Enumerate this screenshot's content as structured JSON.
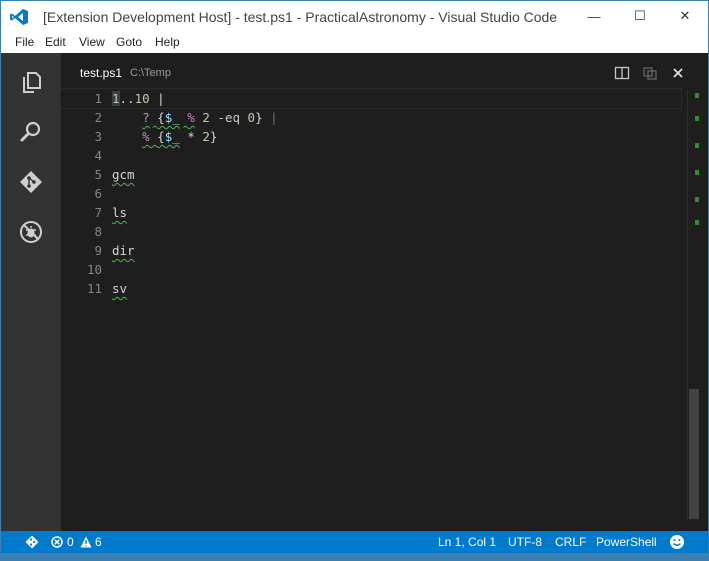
{
  "window": {
    "title": "[Extension Development Host] - test.ps1 - PracticalAstronomy - Visual Studio Code",
    "controls": {
      "minimize": "—",
      "maximize": "☐",
      "close": "✕"
    }
  },
  "menu": {
    "file": "File",
    "edit": "Edit",
    "view": "View",
    "goto": "Goto",
    "help": "Help"
  },
  "activity_bar": {
    "icons": [
      "files-icon",
      "search-icon",
      "git-icon",
      "debug-icon"
    ]
  },
  "editor": {
    "tab_title": "test.ps1",
    "tab_path": "C:\\Temp",
    "lines": [
      {
        "num": "1",
        "text": "1..10 |"
      },
      {
        "num": "2",
        "text": "    ? {$_ % 2 -eq 0} |"
      },
      {
        "num": "3",
        "text": "    % {$_ * 2}"
      },
      {
        "num": "4",
        "text": ""
      },
      {
        "num": "5",
        "text": "gcm"
      },
      {
        "num": "6",
        "text": ""
      },
      {
        "num": "7",
        "text": "ls"
      },
      {
        "num": "8",
        "text": ""
      },
      {
        "num": "9",
        "text": "dir"
      },
      {
        "num": "10",
        "text": ""
      },
      {
        "num": "11",
        "text": "sv"
      }
    ]
  },
  "status_bar": {
    "errors": "0",
    "warnings": "6",
    "position": "Ln 1, Col 1",
    "encoding": "UTF-8",
    "line_ending": "CRLF",
    "language": "PowerShell"
  },
  "colors": {
    "status_bar": "#007acc",
    "activity_bar": "#333333",
    "editor_bg": "#1e1e1e"
  }
}
